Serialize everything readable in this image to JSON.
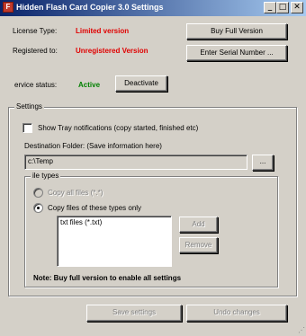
{
  "window": {
    "title": "Hidden Flash Card Copier 3.0 Settings",
    "icon": "app-icon",
    "controls": {
      "minimize": "_",
      "maximize": "□",
      "close": "✕"
    }
  },
  "license": {
    "type_label": "License Type:",
    "type_value": "Limited version",
    "registered_label": "Registered to:",
    "registered_value": "Unregistered Version",
    "status_label": "ervice status:",
    "status_value": "Active",
    "buy_button": "Buy Full Version",
    "serial_button": "Enter Serial Number ...",
    "deactivate_button": "Deactivate"
  },
  "settings": {
    "group_caption": "Settings",
    "tray_checkbox_label": "Show Tray notifications (copy started, finished etc)",
    "tray_checked": false,
    "destination_label": "Destination Folder: (Save information here)",
    "destination_value": "c:\\Temp",
    "browse_button": "...",
    "filetypes": {
      "caption": "ile types",
      "option_all": "Copy all files (*.*)",
      "option_these": "Copy files of these types only",
      "selected": "these",
      "list": [
        "txt files (*.txt)"
      ],
      "add_button": "Add",
      "remove_button": "Remove"
    },
    "note": "Note:  Buy full version to enable all settings"
  },
  "footer": {
    "save_button": "Save settings",
    "undo_button": "Undo changes"
  },
  "colors": {
    "limited": "#e00000",
    "active": "#008000",
    "face": "#d4d0c8"
  }
}
